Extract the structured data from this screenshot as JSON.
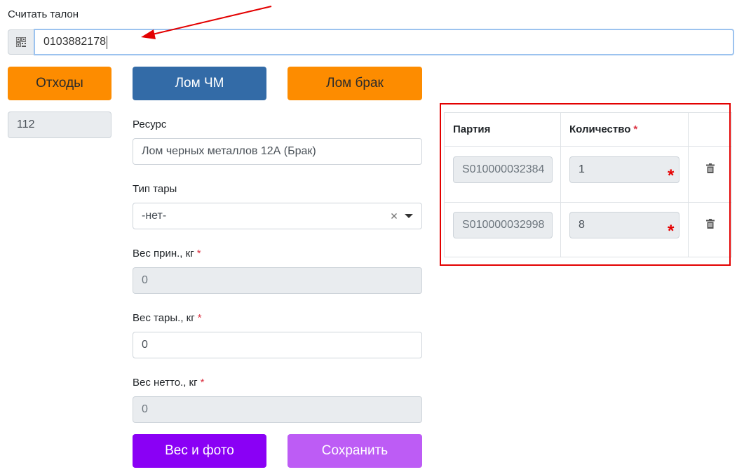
{
  "scan": {
    "label": "Считать талон",
    "value": "0103882178"
  },
  "buttons": {
    "waste": "Отходы",
    "scrap_cm": "Лом ЧМ",
    "scrap_defect": "Лом брак",
    "weigh_photo": "Вес и фото",
    "save": "Сохранить"
  },
  "left_field": {
    "value": "112"
  },
  "form": {
    "resource_label": "Ресурс",
    "resource_value": "Лом черных металлов 12А (Брак)",
    "tare_type_label": "Тип тары",
    "tare_type_value": "-нет-",
    "weight_recv_label": "Вес прин., кг",
    "weight_recv_value": "0",
    "weight_tare_label": "Вес тары., кг",
    "weight_tare_value": "0",
    "weight_net_label": "Вес нетто., кг",
    "weight_net_value": "0",
    "required_mark": "*"
  },
  "parts_table": {
    "headers": {
      "batch": "Партия",
      "qty": "Количество"
    },
    "rows": [
      {
        "batch": "S010000032384",
        "qty": "1"
      },
      {
        "batch": "S010000032998",
        "qty": "8"
      }
    ]
  },
  "colors": {
    "orange": "#fd8c00",
    "blue": "#336ba7",
    "purple": "#8a00f5",
    "purple_light": "#bd5cf5",
    "annotation_red": "#e30000"
  },
  "icons": {
    "scan": "qr-code-icon",
    "clear": "clear-x-icon",
    "dropdown": "caret-down-icon",
    "delete": "trash-icon"
  }
}
